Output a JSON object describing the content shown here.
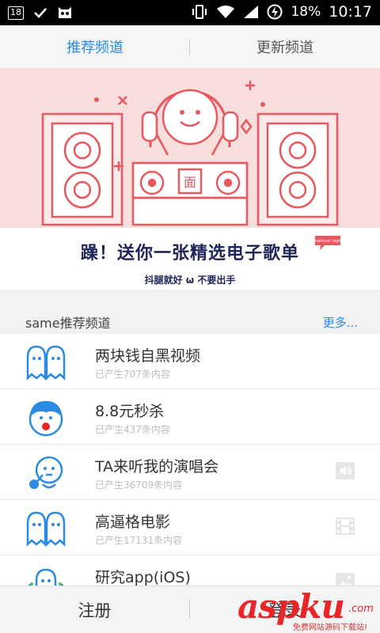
{
  "status_bar": {
    "notification_count": "18",
    "battery": "18%",
    "time": "10:17"
  },
  "tabs": [
    {
      "label": "推荐频道",
      "active": true
    },
    {
      "label": "更新频道",
      "active": false
    }
  ],
  "banner": {
    "title": "躁！送你一张精选电子歌单",
    "subtitle": "抖腿就好 ω 不要出手",
    "logo_text": "面",
    "tag_text": "national high"
  },
  "section": {
    "title": "same推荐频道",
    "more": "更多..."
  },
  "channels": [
    {
      "title": "两块钱自黑视频",
      "subtitle": "已产生707条内容",
      "icon": "ghost-pair-icon",
      "right_icon": ""
    },
    {
      "title": "8.8元秒杀",
      "subtitle": "已产生437条内容",
      "icon": "shouting-face-icon",
      "right_icon": ""
    },
    {
      "title": "TA来听我的演唱会",
      "subtitle": "已产生36709条内容",
      "icon": "singer-microphone-icon",
      "right_icon": "audio-icon"
    },
    {
      "title": "高逼格电影",
      "subtitle": "已产生17131条内容",
      "icon": "ghost-pair-icon",
      "right_icon": "film-icon"
    },
    {
      "title": "研究app(iOS)",
      "subtitle": "",
      "icon": "ghost-group-icon",
      "right_icon": "image-icon"
    }
  ],
  "bottom_bar": {
    "register": "注册",
    "login": "登录"
  },
  "watermark": {
    "text": "aspku",
    "suffix": ".com",
    "sub": "免费网站源码下载站!"
  },
  "colors": {
    "accent": "#2b8be2",
    "banner_pink": "#f9dede",
    "banner_line": "#e8585f",
    "title_navy": "#1f2558"
  }
}
